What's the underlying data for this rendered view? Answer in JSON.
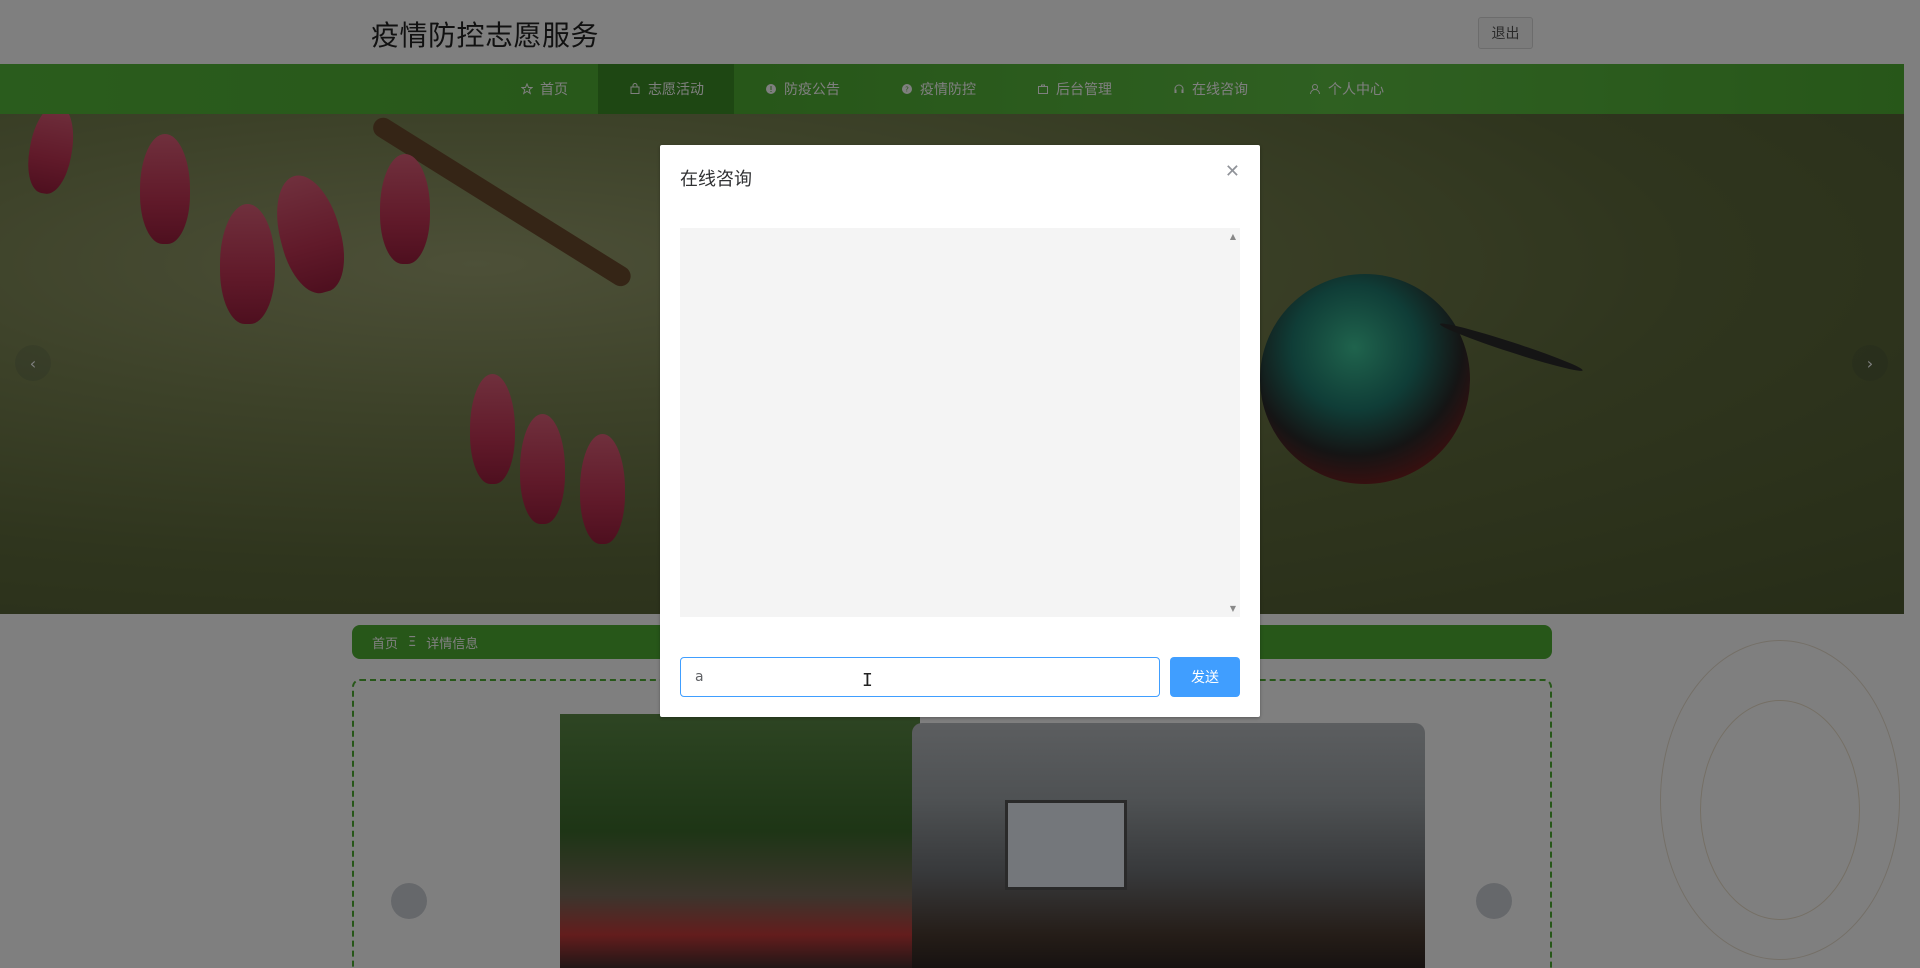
{
  "header": {
    "site_title": "疫情防控志愿服务",
    "logout_label": "退出"
  },
  "nav": {
    "items": [
      {
        "label": "首页",
        "icon": "star-icon",
        "active": false
      },
      {
        "label": "志愿活动",
        "icon": "bag-icon",
        "active": true
      },
      {
        "label": "防疫公告",
        "icon": "info-circle-icon",
        "active": false
      },
      {
        "label": "疫情防控",
        "icon": "question-circle-icon",
        "active": false
      },
      {
        "label": "后台管理",
        "icon": "briefcase-icon",
        "active": false
      },
      {
        "label": "在线咨询",
        "icon": "headset-icon",
        "active": false
      },
      {
        "label": "个人中心",
        "icon": "user-icon",
        "active": false
      }
    ]
  },
  "banner": {
    "prev_icon": "chevron-left-icon",
    "next_icon": "chevron-right-icon"
  },
  "breadcrumb": {
    "home": "首页",
    "separator": "Ξ",
    "current": "详情信息"
  },
  "dialog": {
    "title": "在线咨询",
    "close_icon": "close-icon",
    "input_value": "a",
    "send_label": "发送"
  },
  "colors": {
    "nav_green": "#4fae33",
    "nav_active": "#3d8f26",
    "primary_blue": "#409eff"
  }
}
